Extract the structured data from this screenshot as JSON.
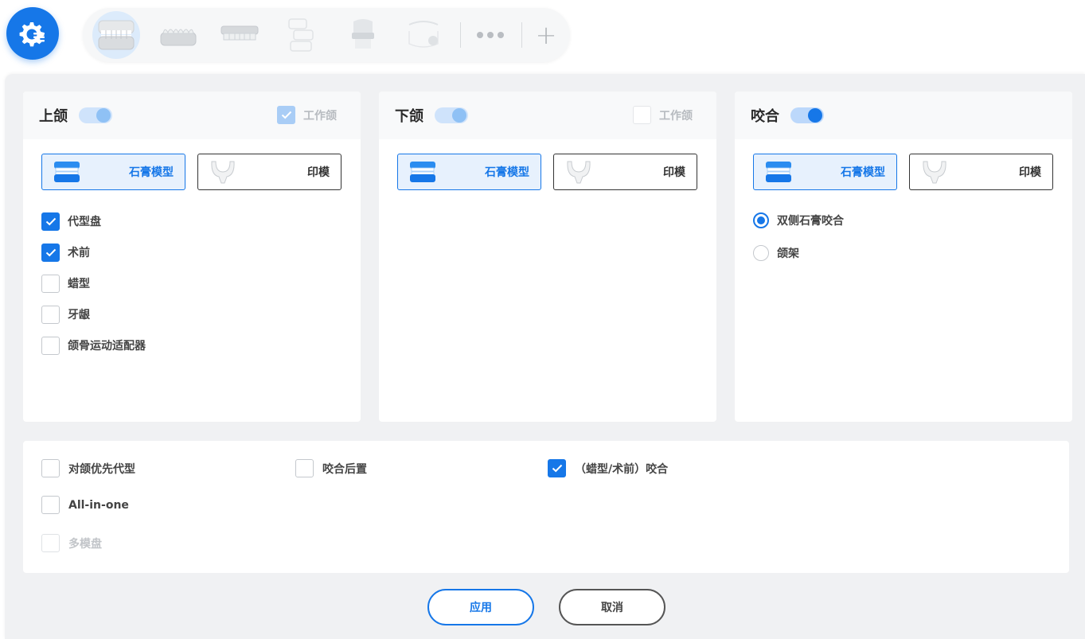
{
  "toolbar": {
    "tools": [
      {
        "icon": "full-arch-model-icon",
        "active": true
      },
      {
        "icon": "lower-arch-model-icon",
        "active": false
      },
      {
        "icon": "upper-arch-tray-icon",
        "active": false
      },
      {
        "icon": "stacked-models-icon",
        "active": false
      },
      {
        "icon": "single-tooth-icon",
        "active": false
      },
      {
        "icon": "model-scan-icon",
        "active": false
      }
    ],
    "more_icon": "more-dots-icon",
    "add_icon": "plus-icon"
  },
  "upper": {
    "title": "上颌",
    "toggle_on": true,
    "work_jaw_label": "工作颌",
    "work_jaw_checked": true,
    "seg_plaster": "石膏模型",
    "seg_impression": "印模",
    "options": [
      "代型盘",
      "术前",
      "蜡型",
      "牙龈",
      "颌骨运动适配器"
    ],
    "options_checked": [
      true,
      true,
      false,
      false,
      false
    ]
  },
  "lower": {
    "title": "下颌",
    "toggle_on": true,
    "work_jaw_label": "工作颌",
    "work_jaw_checked": false,
    "seg_plaster": "石膏模型",
    "seg_impression": "印模"
  },
  "bite": {
    "title": "咬合",
    "toggle_on": true,
    "seg_plaster": "石膏模型",
    "seg_impression": "印模",
    "radios": [
      "双侧石膏咬合",
      "颌架"
    ],
    "radio_selected": 0
  },
  "bottom": {
    "opposing_first": "对颌优先代型",
    "bite_after": "咬合后置",
    "wax_preop_bite": "（蜡型/术前）咬合",
    "all_in_one": "All-in-one",
    "multi_die": "多模盘"
  },
  "actions": {
    "apply": "应用",
    "cancel": "取消"
  },
  "colors": {
    "accent": "#1677e8",
    "panel_bg": "#f0f1f3"
  }
}
